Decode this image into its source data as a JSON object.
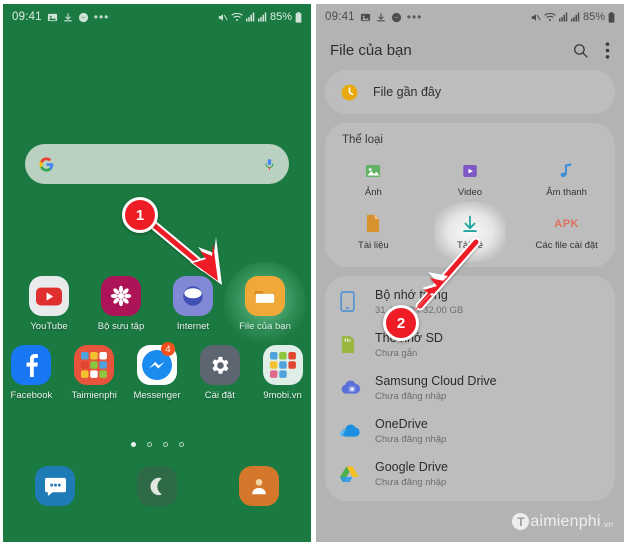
{
  "colors": {
    "home_green": "#1b7a42",
    "panel_grey": "#b3b3b3",
    "card_grey": "#bdbdbd",
    "marker_red": "#ee1c25",
    "download_teal": "#1fa8a0",
    "apk_red": "#e0705f"
  },
  "status_bar": {
    "time": "09:41",
    "battery_percent": "85%",
    "left_icons": [
      "image-icon",
      "download-icon",
      "messenger-icon",
      "more-dots-icon"
    ],
    "right_icons": [
      "volume-off-icon",
      "wifi-icon",
      "signal-icon",
      "signal-icon",
      "battery-icon"
    ]
  },
  "home": {
    "search": {
      "logo_icon": "google-g-icon",
      "mic_icon": "microphone-icon",
      "placeholder": ""
    },
    "apps_row1": [
      {
        "label": "YouTube",
        "icon": "youtube-icon",
        "highlighted": false
      },
      {
        "label": "Bộ sưu tập",
        "icon": "gallery-icon",
        "highlighted": false
      },
      {
        "label": "Internet",
        "icon": "internet-icon",
        "highlighted": false
      },
      {
        "label": "File của bạn",
        "icon": "my-files-icon",
        "highlighted": true
      }
    ],
    "apps_row2": [
      {
        "label": "Facebook",
        "icon": "facebook-icon",
        "badge": ""
      },
      {
        "label": "Taimienphi",
        "icon": "folder-icon",
        "badge": ""
      },
      {
        "label": "Messenger",
        "icon": "messenger-icon",
        "badge": "4"
      },
      {
        "label": "Cài đặt",
        "icon": "settings-gear-icon",
        "badge": ""
      },
      {
        "label": "9mobi.vn",
        "icon": "folder-icon",
        "badge": ""
      }
    ],
    "page_dots": {
      "count": 4,
      "active_index": 0
    },
    "dock": [
      {
        "label": "Messages",
        "icon": "messages-icon"
      },
      {
        "label": "Phone",
        "icon": "phone-icon"
      },
      {
        "label": "Contacts",
        "icon": "contacts-icon"
      }
    ]
  },
  "file_manager": {
    "title": "File của bạn",
    "search_icon": "search-icon",
    "menu_icon": "more-vertical-icon",
    "recent": {
      "label": "File gần đây",
      "icon": "clock-icon"
    },
    "categories_title": "Thể loại",
    "categories": [
      {
        "label": "Ảnh",
        "icon": "photo-icon",
        "highlighted": false
      },
      {
        "label": "Video",
        "icon": "video-icon",
        "highlighted": false
      },
      {
        "label": "Âm thanh",
        "icon": "audio-note-icon",
        "highlighted": false
      },
      {
        "label": "Tài liệu",
        "icon": "document-icon",
        "highlighted": false
      },
      {
        "label": "Tải về",
        "icon": "download-arrow-icon",
        "highlighted": true
      },
      {
        "label": "Các file cài đặt",
        "icon": "apk-icon",
        "icon_text": "APK",
        "highlighted": false
      }
    ],
    "storage": [
      {
        "name": "Bộ nhớ trong",
        "detail": "31,43 GB / 32,00 GB",
        "icon": "phone-storage-icon"
      },
      {
        "name": "Thẻ nhớ SD",
        "detail": "Chưa gắn",
        "icon": "sd-card-icon"
      },
      {
        "name": "Samsung Cloud Drive",
        "detail": "Chưa đăng nhập",
        "icon": "samsung-cloud-icon"
      },
      {
        "name": "OneDrive",
        "detail": "Chưa đăng nhập",
        "icon": "onedrive-icon"
      },
      {
        "name": "Google Drive",
        "detail": "Chưa đăng nhập",
        "icon": "google-drive-icon"
      }
    ]
  },
  "annotations": [
    {
      "number": "1",
      "target": "File của bạn app icon"
    },
    {
      "number": "2",
      "target": "Tải về category"
    }
  ],
  "watermark": {
    "logo": "T",
    "text": "aimienphi",
    "suffix": ".vn"
  }
}
